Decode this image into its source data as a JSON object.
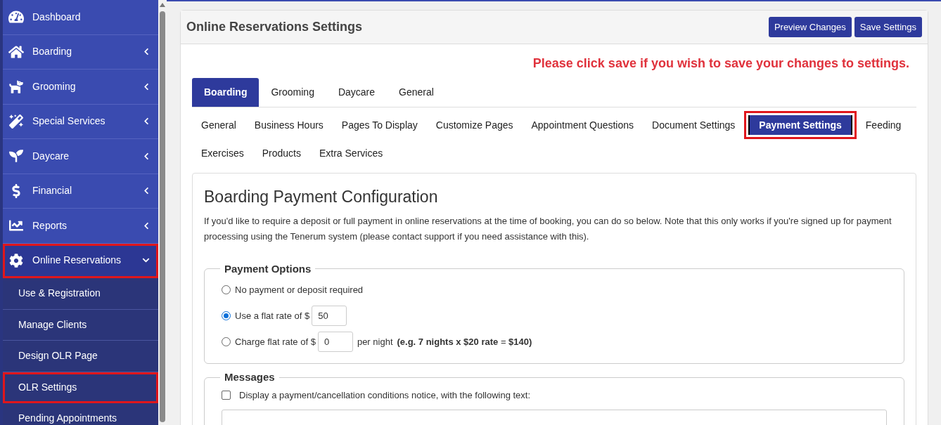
{
  "sidebar": {
    "items": [
      {
        "label": "Dashboard",
        "has_submenu": false,
        "expanded": false,
        "highlighted": false
      },
      {
        "label": "Boarding",
        "has_submenu": true,
        "expanded": false,
        "highlighted": false
      },
      {
        "label": "Grooming",
        "has_submenu": true,
        "expanded": false,
        "highlighted": false
      },
      {
        "label": "Special Services",
        "has_submenu": true,
        "expanded": false,
        "highlighted": false
      },
      {
        "label": "Daycare",
        "has_submenu": true,
        "expanded": false,
        "highlighted": false
      },
      {
        "label": "Financial",
        "has_submenu": true,
        "expanded": false,
        "highlighted": false
      },
      {
        "label": "Reports",
        "has_submenu": true,
        "expanded": false,
        "highlighted": false
      },
      {
        "label": "Online Reservations",
        "has_submenu": true,
        "expanded": true,
        "highlighted": true,
        "children": [
          {
            "label": "Use & Registration",
            "highlighted": false
          },
          {
            "label": "Manage Clients",
            "highlighted": false
          },
          {
            "label": "Design OLR Page",
            "highlighted": false
          },
          {
            "label": "OLR Settings",
            "highlighted": true
          },
          {
            "label": "Pending Appointments",
            "highlighted": false
          }
        ]
      }
    ]
  },
  "panel": {
    "title": "Online Reservations Settings",
    "buttons": [
      "Preview Changes",
      "Save Settings"
    ],
    "notice": "Please click save if you wish to save your changes to settings.",
    "tabs": [
      {
        "label": "Boarding",
        "selected": true
      },
      {
        "label": "Grooming",
        "selected": false
      },
      {
        "label": "Daycare",
        "selected": false
      },
      {
        "label": "General",
        "selected": false
      }
    ],
    "subtabs": [
      {
        "label": "General",
        "selected": false,
        "highlighted": false
      },
      {
        "label": "Business Hours",
        "selected": false,
        "highlighted": false
      },
      {
        "label": "Pages To Display",
        "selected": false,
        "highlighted": false
      },
      {
        "label": "Customize Pages",
        "selected": false,
        "highlighted": false
      },
      {
        "label": "Appointment Questions",
        "selected": false,
        "highlighted": false
      },
      {
        "label": "Document Settings",
        "selected": false,
        "highlighted": false
      },
      {
        "label": "Payment Settings",
        "selected": true,
        "highlighted": true
      },
      {
        "label": "Feeding",
        "selected": false,
        "highlighted": false
      },
      {
        "label": "Exercises",
        "selected": false,
        "highlighted": false
      },
      {
        "label": "Products",
        "selected": false,
        "highlighted": false
      },
      {
        "label": "Extra Services",
        "selected": false,
        "highlighted": false
      }
    ]
  },
  "config": {
    "title": "Boarding Payment Configuration",
    "description": "If you'd like to require a deposit or full payment in online reservations at the time of booking, you can do so below. Note that this only works if you're signed up for payment processing using the Tenerum system (please contact support if you need assistance with this).",
    "payment_options": {
      "legend": "Payment Options",
      "options": [
        {
          "kind": "plain",
          "label": "No payment or deposit required",
          "selected": false
        },
        {
          "kind": "amount",
          "label": "Use a flat rate of $",
          "value": "50",
          "selected": true
        },
        {
          "kind": "per_night",
          "label": "Charge flat rate of $",
          "value": "0",
          "suffix": "per night",
          "note": "**(e.g. 7 nights x $20 rate** = **$140)**",
          "selected": false
        }
      ]
    },
    "messages": {
      "legend": "Messages",
      "checkbox_label": "Display a payment/cancellation conditions notice, with the following text:",
      "checked": false
    }
  }
}
